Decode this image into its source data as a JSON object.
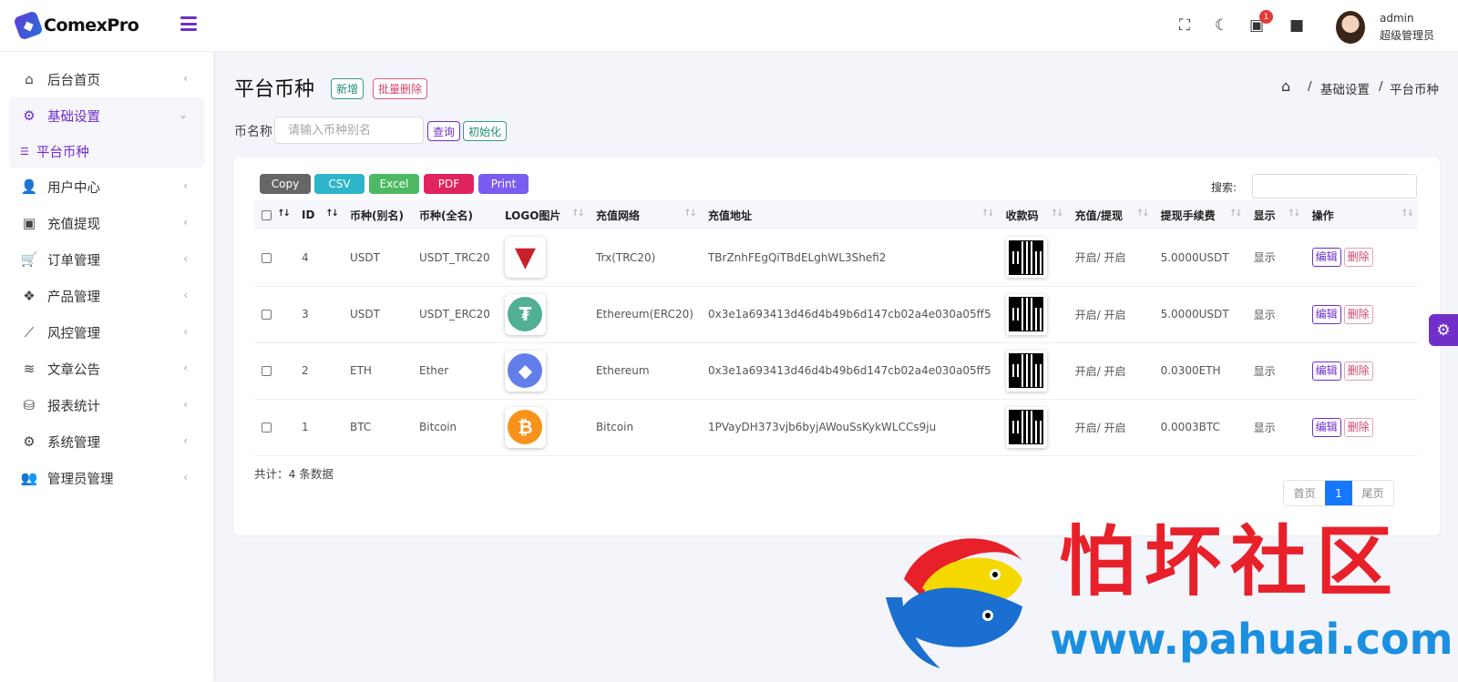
{
  "brand": {
    "name": "ComexPro"
  },
  "sidebar": {
    "items": [
      {
        "label": "后台首页",
        "icon": "home-icon"
      },
      {
        "label": "基础设置",
        "icon": "cogs-icon"
      },
      {
        "label": "平台币种",
        "icon": "list-icon"
      },
      {
        "label": "用户中心",
        "icon": "users-icon"
      },
      {
        "label": "充值提现",
        "icon": "money-icon"
      },
      {
        "label": "订单管理",
        "icon": "cart-icon"
      },
      {
        "label": "产品管理",
        "icon": "cubes-icon"
      },
      {
        "label": "风控管理",
        "icon": "chart-line-icon"
      },
      {
        "label": "文章公告",
        "icon": "layers-icon"
      },
      {
        "label": "报表统计",
        "icon": "database-icon"
      },
      {
        "label": "系统管理",
        "icon": "gear-icon"
      },
      {
        "label": "管理员管理",
        "icon": "user-group-icon"
      }
    ]
  },
  "header": {
    "notification_count": "1",
    "user_name": "admin",
    "user_role": "超级管理员"
  },
  "page": {
    "title": "平台币种",
    "add_label": "新增",
    "bulk_delete_label": "批量删除",
    "breadcrumb": [
      "基础设置",
      "平台币种"
    ],
    "breadcrumb_sep": "/"
  },
  "filter": {
    "label": "币名称",
    "placeholder": "请输入币种别名",
    "query_label": "查询",
    "init_label": "初始化"
  },
  "export_buttons": [
    {
      "label": "Copy",
      "color": "#666666"
    },
    {
      "label": "CSV",
      "color": "#2db5c9"
    },
    {
      "label": "Excel",
      "color": "#4cb963"
    },
    {
      "label": "PDF",
      "color": "#e0245e"
    },
    {
      "label": "Print",
      "color": "#7a5cf0"
    }
  ],
  "search": {
    "label": "搜索:"
  },
  "table": {
    "columns": [
      "ID",
      "币种(别名)",
      "币种(全名)",
      "LOGO图片",
      "充值网络",
      "充值地址",
      "收款码",
      "充值/提现",
      "提现手续费",
      "显示",
      "操作"
    ],
    "rows": [
      {
        "id": "4",
        "alias": "USDT",
        "full": "USDT_TRC20",
        "logo": "tron-usdt-logo",
        "network": "Trx(TRC20)",
        "address": "TBrZnhFEgQiTBdELghWL3Shefi2",
        "status": "开启/ 开启",
        "fee": "5.0000USDT",
        "display": "显示"
      },
      {
        "id": "3",
        "alias": "USDT",
        "full": "USDT_ERC20",
        "logo": "tether-logo",
        "network": "Ethereum(ERC20)",
        "address": "0x3e1a693413d46d4b49b6d147cb02a4e030a05ff5",
        "status": "开启/ 开启",
        "fee": "5.0000USDT",
        "display": "显示"
      },
      {
        "id": "2",
        "alias": "ETH",
        "full": "Ether",
        "logo": "ethereum-logo",
        "network": "Ethereum",
        "address": "0x3e1a693413d46d4b49b6d147cb02a4e030a05ff5",
        "status": "开启/ 开启",
        "fee": "0.0300ETH",
        "display": "显示"
      },
      {
        "id": "1",
        "alias": "BTC",
        "full": "Bitcoin",
        "logo": "bitcoin-logo",
        "network": "Bitcoin",
        "address": "1PVayDH373vjb6byjAWouSsKykWLCCs9ju",
        "status": "开启/ 开启",
        "fee": "0.0003BTC",
        "display": "显示"
      }
    ],
    "edit_label": "编辑",
    "delete_label": "删除"
  },
  "footer": {
    "total_text": "共计：4 条数据",
    "pager": {
      "first": "首页",
      "current": "1",
      "last": "尾页"
    }
  },
  "watermark": {
    "text_cn": "怕坏社区",
    "url": "www.pahuai.com"
  },
  "colors": {
    "accent": "#6f2fc8",
    "pager_active": "#1677ff"
  }
}
